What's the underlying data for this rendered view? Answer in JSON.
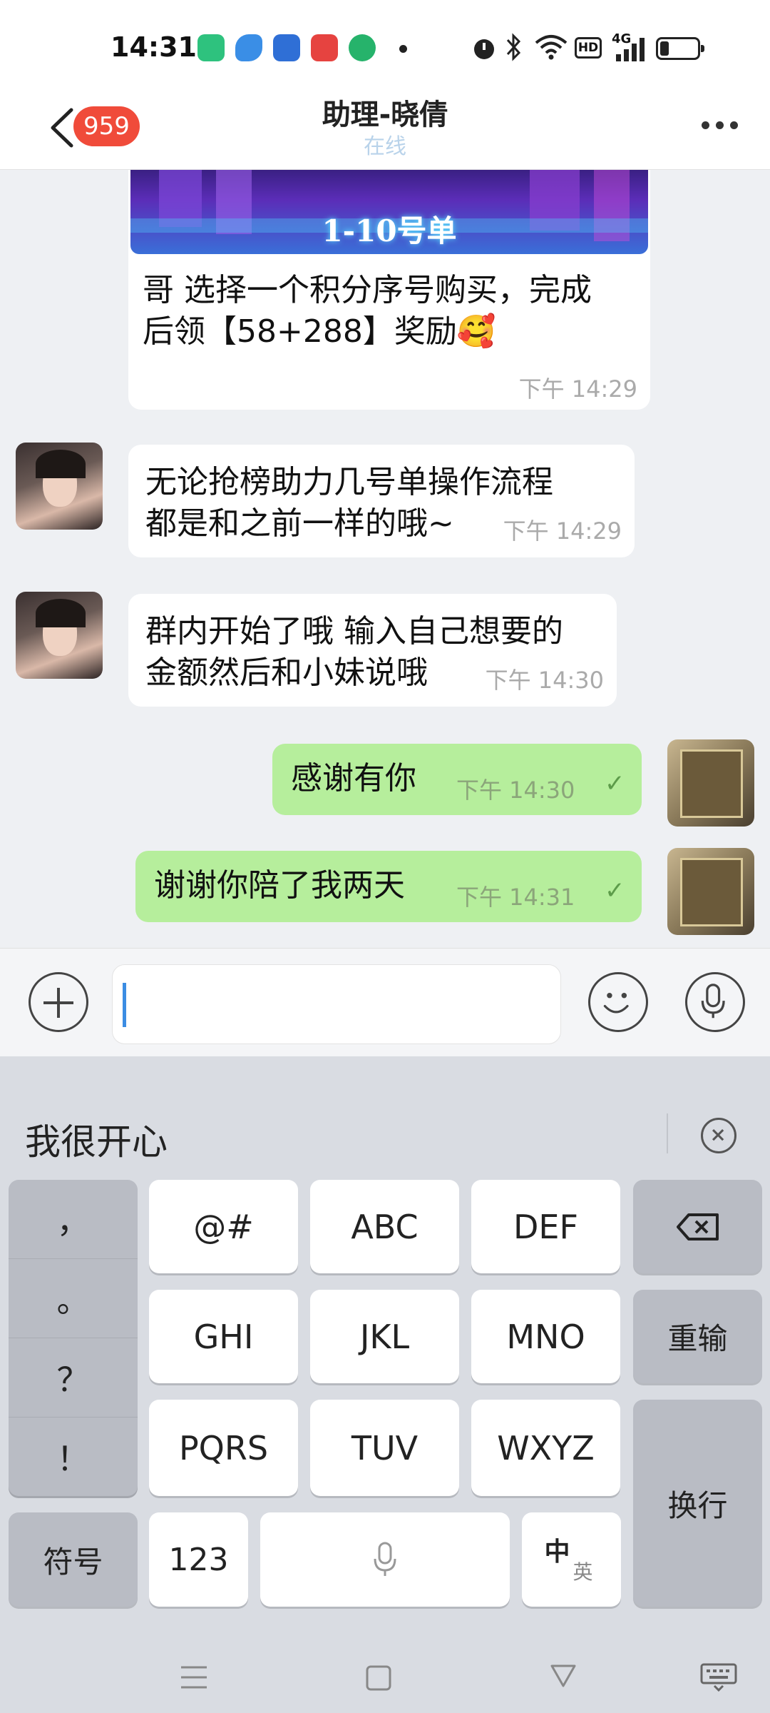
{
  "status_bar": {
    "time": "14:31",
    "network_label": "HD",
    "signal_label": "4G"
  },
  "header": {
    "unread_count": "959",
    "title": "助理-晓倩",
    "subtitle": "在线"
  },
  "messages": [
    {
      "side": "left",
      "banner_text": "1-10号单",
      "text_line1": "哥  选择一个积分序号购买，完成",
      "text_line2": "后领【58+288】奖励🥰",
      "time": "下午 14:29"
    },
    {
      "side": "left",
      "text_line1": "无论抢榜助力几号单操作流程",
      "text_line2": "都是和之前一样的哦~",
      "time": "下午 14:29"
    },
    {
      "side": "left",
      "text_line1": "群内开始了哦 输入自己想要的",
      "text_line2": "金额然后和小妹说哦",
      "time": "下午 14:30"
    },
    {
      "side": "right",
      "text": "感谢有你",
      "time": "下午 14:30",
      "status": "✓"
    },
    {
      "side": "right",
      "text": "谢谢你陪了我两天",
      "time": "下午 14:31",
      "status": "✓"
    }
  ],
  "input": {
    "value": "",
    "placeholder": ""
  },
  "keyboard": {
    "suggestion": "我很开心",
    "punctuation": [
      "，",
      "。",
      "？",
      "！"
    ],
    "keys": {
      "at": "@#",
      "abc": "ABC",
      "def": "DEF",
      "ghi": "GHI",
      "jkl": "JKL",
      "mno": "MNO",
      "reenter": "重输",
      "pqrs": "PQRS",
      "tuv": "TUV",
      "wxyz": "WXYZ",
      "enter": "换行",
      "symbols": "符号",
      "numbers": "123",
      "lang_main": "中",
      "lang_sub": "英"
    }
  },
  "colors": {
    "accent": "#3b8de3",
    "badge": "#f04b3a",
    "sent_bubble": "#b6ee9c",
    "chat_bg": "#eef0f3"
  },
  "icons": [
    "back-icon",
    "more-icon",
    "plus-icon",
    "emoji-icon",
    "microphone-icon",
    "backspace-icon",
    "close-circle-icon",
    "menu-icon",
    "home-icon",
    "back-triangle-icon",
    "keyboard-icon"
  ]
}
